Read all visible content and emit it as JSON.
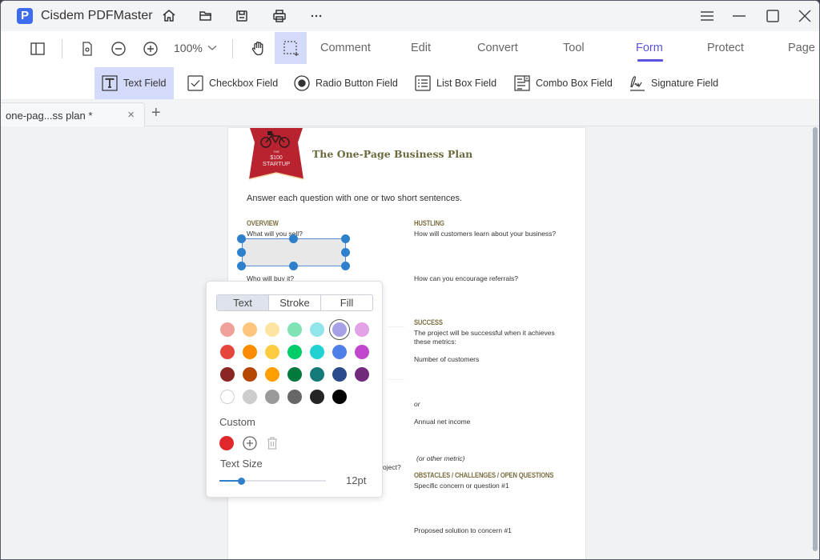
{
  "app": {
    "title": "Cisdem PDFMaster",
    "logo_letter": "P",
    "logo_color": "#3d6cf0"
  },
  "titlebar": {
    "icons": [
      "home-icon",
      "open-folder-icon",
      "save-icon",
      "print-icon",
      "more-icon"
    ],
    "window_controls": [
      "menu-icon",
      "minimize-icon",
      "maximize-icon",
      "close-icon"
    ]
  },
  "toolbar": {
    "zoom_level": "100%",
    "tabs": [
      {
        "label": "Comment",
        "active": false
      },
      {
        "label": "Edit",
        "active": false
      },
      {
        "label": "Convert",
        "active": false
      },
      {
        "label": "Tool",
        "active": false
      },
      {
        "label": "Form",
        "active": true
      },
      {
        "label": "Protect",
        "active": false
      },
      {
        "label": "Page",
        "active": false
      }
    ],
    "accent_color": "#5a55e0"
  },
  "form_toolbar": {
    "items": [
      {
        "label": "Text Field",
        "active": true
      },
      {
        "label": "Checkbox Field",
        "active": false
      },
      {
        "label": "Radio Button Field",
        "active": false
      },
      {
        "label": "List Box Field",
        "active": false
      },
      {
        "label": "Combo Box Field",
        "active": false
      },
      {
        "label": "Signature Field",
        "active": false
      }
    ]
  },
  "tabs": {
    "documents": [
      {
        "label": "one-pag...ss plan *"
      }
    ],
    "close_symbol": "×",
    "add_symbol": "+"
  },
  "document": {
    "logo": {
      "line1": "THE",
      "line2": "$100",
      "line3": "STARTUP"
    },
    "title": "The One-Page Business Plan",
    "instructions": "Answer each question with one or two short sentences.",
    "left_column": {
      "heading": "OVERVIEW",
      "q1": "What will you sell?",
      "q2": "Who will buy it?",
      "partial": "oject?"
    },
    "right_column": {
      "hustling_heading": "HUSTLING",
      "hustling_q1": "How will customers learn about your business?",
      "hustling_q2": "How can you encourage referrals?",
      "success_heading": "SUCCESS",
      "success_text_1": "The project will be successful when it achieves",
      "success_text_2": "these metrics:",
      "metric_1": "Number of customers",
      "or": "or",
      "metric_2": "Annual net income",
      "metric_3": "(or other metric)",
      "obstacles_heading": "OBSTACLES / CHALLENGES / OPEN QUESTIONS",
      "obstacles_q1": "Specific concern or question #1",
      "obstacles_q2": "Proposed solution to concern #1"
    }
  },
  "color_popup": {
    "segments": [
      {
        "label": "Text",
        "active": true
      },
      {
        "label": "Stroke",
        "active": false
      },
      {
        "label": "Fill",
        "active": false
      }
    ],
    "swatches": [
      [
        "#f1a09b",
        "#fec57d",
        "#fde4a0",
        "#80e3b4",
        "#90e6e9",
        "#a6a0e7",
        "#e3a2e8"
      ],
      [
        "#e5453d",
        "#ff8c00",
        "#ffcb40",
        "#00cc6a",
        "#22d2d2",
        "#4f80ea",
        "#c247cf"
      ],
      [
        "#8a2623",
        "#b34700",
        "#ff9f00",
        "#007a3d",
        "#157a7a",
        "#2d4a8c",
        "#722a7a"
      ],
      [
        "#ffffff",
        "#cccccc",
        "#9a9a9a",
        "#666666",
        "#242424",
        "#000000"
      ]
    ],
    "selected_swatch": "#a6a0e7",
    "custom_label": "Custom",
    "custom_color": "#e0282c",
    "text_size_label": "Text Size",
    "text_size_value": "12pt",
    "text_size_fraction": 0.2
  }
}
